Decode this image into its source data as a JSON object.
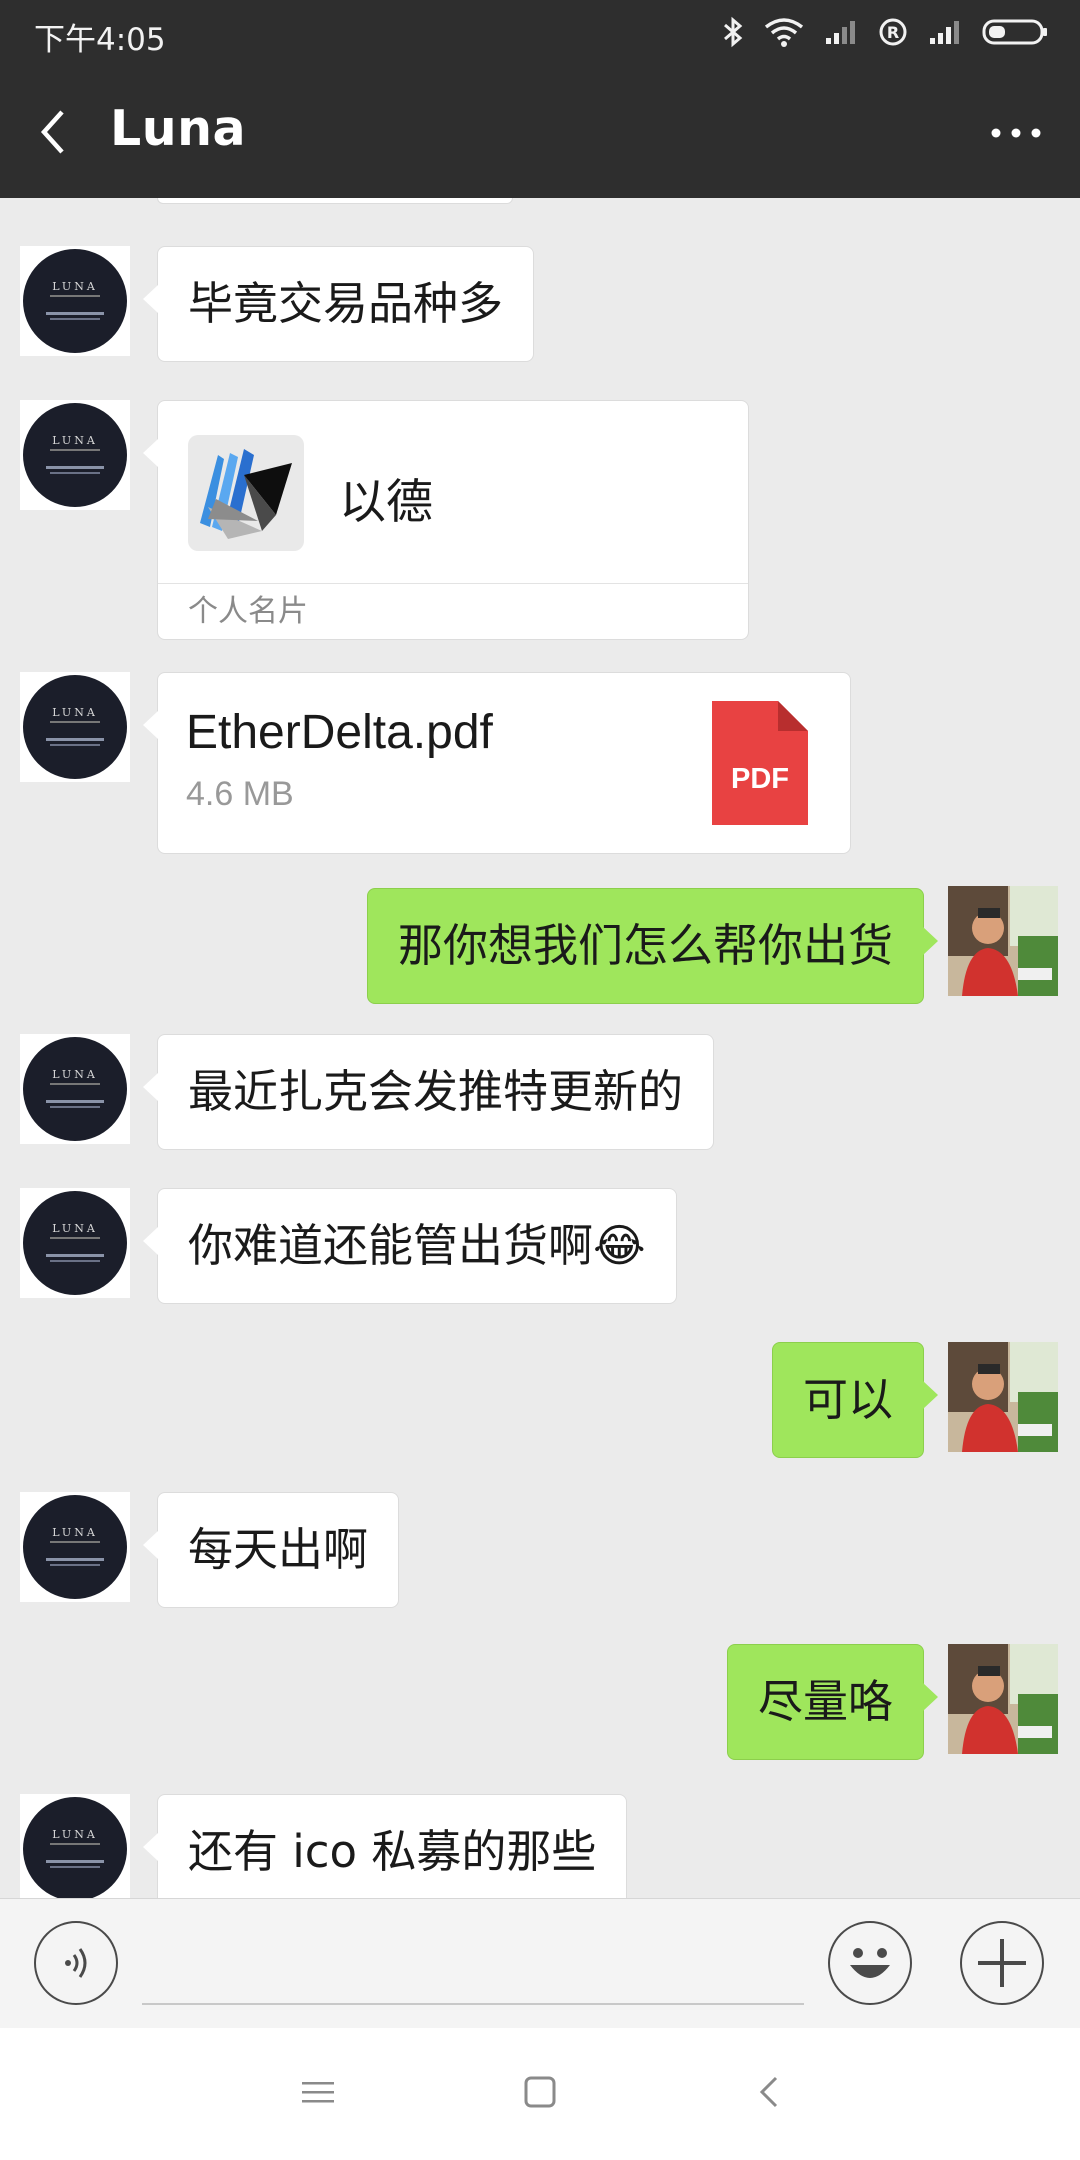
{
  "status_bar": {
    "time": "下午4:05",
    "icons": [
      "bluetooth-icon",
      "wifi-icon",
      "signal-icon",
      "registered-icon",
      "signal-icon",
      "battery-icon"
    ]
  },
  "header": {
    "back_icon": "chevron-left-icon",
    "title": "Luna",
    "more_icon": "more-icon"
  },
  "messages": [
    {
      "side": "in",
      "type": "text",
      "text": "毕竟交易品种多"
    },
    {
      "side": "in",
      "type": "contact_card",
      "name": "以德",
      "footer": "个人名片"
    },
    {
      "side": "in",
      "type": "file",
      "file_name": "EtherDelta.pdf",
      "file_size": "4.6 MB",
      "file_badge": "PDF"
    },
    {
      "side": "out",
      "type": "text",
      "text": "那你想我们怎么帮你出货"
    },
    {
      "side": "in",
      "type": "text",
      "text": "最近扎克会发推特更新的"
    },
    {
      "side": "in",
      "type": "text",
      "text": "你难道还能管出货啊😂"
    },
    {
      "side": "out",
      "type": "text",
      "text": "可以"
    },
    {
      "side": "in",
      "type": "text",
      "text": "每天出啊"
    },
    {
      "side": "out",
      "type": "text",
      "text": "尽量咯"
    },
    {
      "side": "in",
      "type": "text",
      "text": "还有 ico 私募的那些"
    }
  ],
  "avatar_text": {
    "luna": "LUNA"
  },
  "input_bar": {
    "voice_icon": "voice-icon",
    "emoji_icon": "emoji-icon",
    "plus_icon": "plus-icon"
  },
  "system_nav": {
    "icons": [
      "menu-icon",
      "home-icon",
      "back-icon"
    ]
  },
  "colors": {
    "header_bg": "#2e2e2e",
    "chat_bg": "#ebebeb",
    "outgoing_bubble": "#9fe65c",
    "incoming_bubble": "#ffffff",
    "pdf_red": "#e84242"
  }
}
